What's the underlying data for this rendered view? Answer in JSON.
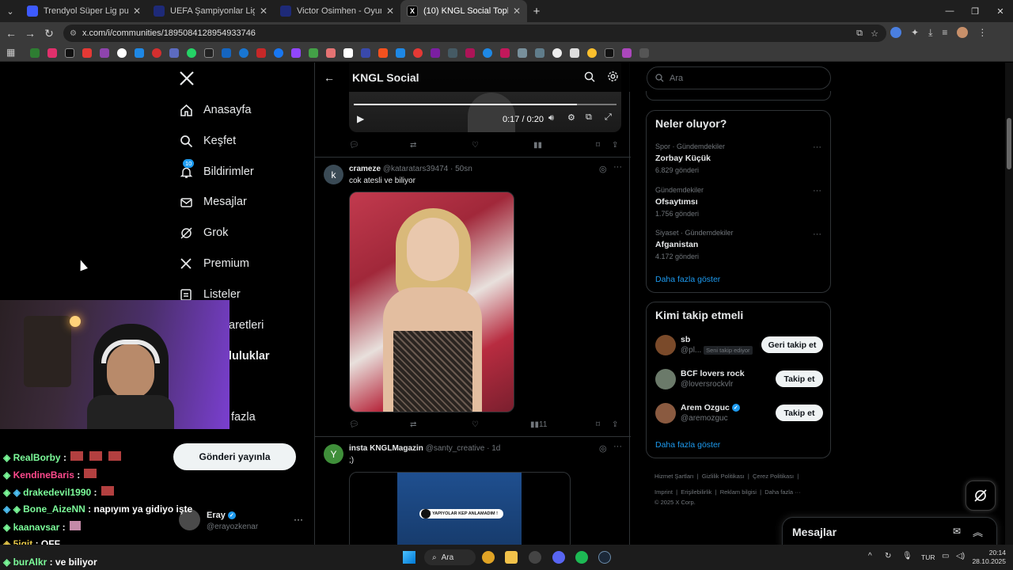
{
  "browser": {
    "tabs": [
      {
        "title": "Trendyol Süper Lig puan tablosu",
        "color": "#3d5afe"
      },
      {
        "title": "UEFA Şampiyonlar Ligi - Gol Kr",
        "color": "#1e2a78"
      },
      {
        "title": "Victor Osimhen - Oyuncu profil",
        "color": "#1e2a78"
      },
      {
        "title": "(10) KNGL Social Topluluk / X",
        "color": "#000000"
      }
    ],
    "url": "x.com/i/communities/1895084128954933746"
  },
  "sidebar": {
    "items": [
      {
        "label": "Anasayfa",
        "icon": "home-icon"
      },
      {
        "label": "Keşfet",
        "icon": "search-icon"
      },
      {
        "label": "Bildirimler",
        "icon": "bell-icon",
        "badge": "10"
      },
      {
        "label": "Mesajlar",
        "icon": "mail-icon"
      },
      {
        "label": "Grok",
        "icon": "grok-icon"
      },
      {
        "label": "Premium",
        "icon": "x-icon"
      },
      {
        "label": "Listeler",
        "icon": "list-icon"
      },
      {
        "label": "aretleri",
        "icon": ""
      },
      {
        "label": "luluklar",
        "icon": ""
      },
      {
        "label": "fazla",
        "icon": ""
      }
    ],
    "post_button": "Gönderi yayınla",
    "account": {
      "name": "Eray",
      "handle": "@erayozkenar"
    }
  },
  "feed": {
    "title": "KNGL Social",
    "video": {
      "time": "0:17 / 0:20",
      "progress": 0.85
    },
    "tweets": [
      {
        "avatar": "k",
        "name": "crameze",
        "handle": "@kataratars39474",
        "time": "· 50sn",
        "text": "cok atesli ve biliyor",
        "views": "11"
      },
      {
        "avatar": "Y",
        "name": "insta KNGLMagazin",
        "handle": "@santy_creative",
        "time": "· 1d",
        "text": ";)",
        "image_caption": "NE YAPIYOLAR KEP ANLAMADIM !"
      }
    ]
  },
  "right": {
    "search_placeholder": "Ara",
    "trends_title": "Neler oluyor?",
    "trends": [
      {
        "category": "Spor · Gündemdekiler",
        "name": "Zorbay Küçük",
        "count": "6.829 gönderi"
      },
      {
        "category": "Gündemdekiler",
        "name": "Ofsaytımsı",
        "count": "1.756 gönderi"
      },
      {
        "category": "Siyaset · Gündemdekiler",
        "name": "Afganistan",
        "count": "4.172 gönderi"
      }
    ],
    "show_more": "Daha fazla göster",
    "follow_title": "Kimi takip etmeli",
    "follow": [
      {
        "name": "sb",
        "handle": "@pl...",
        "tag": "Seni takip ediyor",
        "button": "Geri takip et"
      },
      {
        "name": "BCF lovers rock",
        "handle": "@loversrockvlr",
        "button": "Takip et"
      },
      {
        "name": "Arem Ozguc",
        "handle": "@aremozguc",
        "button": "Takip et"
      }
    ],
    "follow_more": "Daha fazla göster",
    "footer": [
      "Hizmet Şartları",
      "Gizlilik Politikası",
      "Çerez Politikası",
      "Imprint",
      "Erişilebilirlik",
      "Reklam bilgisi",
      "Daha fazla ···",
      "© 2025 X Corp."
    ],
    "messages": "Mesajlar"
  },
  "chat": [
    {
      "user": "RealBorby",
      "msg": ":",
      "color": "#7CFC9A"
    },
    {
      "user": "KendineBaris",
      "msg": ":",
      "color": "#ff4a8d"
    },
    {
      "user": "drakedevil1990",
      "msg": ":",
      "color": "#7CFC9A"
    },
    {
      "user": "Bone_AizeNN",
      "msg": ": napıyım ya gidiyo işte",
      "color": "#7CFC9A"
    },
    {
      "user": "kaanavsar",
      "msg": ":",
      "color": "#7CFC9A"
    },
    {
      "user": "5igit",
      "msg": ": OFF",
      "color": "#e6c84a"
    },
    {
      "user": "burAlkr",
      "msg": ": ve biliyor",
      "color": "#7CFC9A"
    }
  ],
  "taskbar": {
    "search": "Ara",
    "lang": "TUR",
    "time": "20:14",
    "date": "28.10.2025"
  }
}
